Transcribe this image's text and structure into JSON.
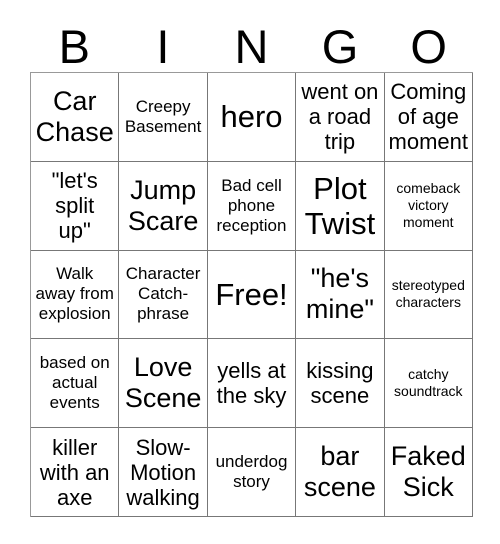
{
  "header": {
    "letters": [
      "B",
      "I",
      "N",
      "G",
      "O"
    ]
  },
  "grid": {
    "rows": [
      [
        {
          "text": "Car\nChase",
          "size": "lg"
        },
        {
          "text": "Creepy\nBasement",
          "size": "sm"
        },
        {
          "text": "hero",
          "size": "xl"
        },
        {
          "text": "went on\na road\ntrip",
          "size": "md"
        },
        {
          "text": "Coming\nof age\nmoment",
          "size": "md"
        }
      ],
      [
        {
          "text": "\"let's\nsplit\nup\"",
          "size": "md"
        },
        {
          "text": "Jump\nScare",
          "size": "lg"
        },
        {
          "text": "Bad cell\nphone\nreception",
          "size": "sm"
        },
        {
          "text": "Plot\nTwist",
          "size": "xl"
        },
        {
          "text": "comeback\nvictory\nmoment",
          "size": "xs"
        }
      ],
      [
        {
          "text": "Walk\naway from\nexplosion",
          "size": "sm"
        },
        {
          "text": "Character\nCatch-\nphrase",
          "size": "sm"
        },
        {
          "text": "Free!",
          "size": "xl"
        },
        {
          "text": "\"he's\nmine\"",
          "size": "lg"
        },
        {
          "text": "stereotyped\ncharacters",
          "size": "xs"
        }
      ],
      [
        {
          "text": "based on\nactual\nevents",
          "size": "sm"
        },
        {
          "text": "Love\nScene",
          "size": "lg"
        },
        {
          "text": "yells at\nthe sky",
          "size": "md"
        },
        {
          "text": "kissing\nscene",
          "size": "md"
        },
        {
          "text": "catchy\nsoundtrack",
          "size": "xs"
        }
      ],
      [
        {
          "text": "killer\nwith an\naxe",
          "size": "md"
        },
        {
          "text": "Slow-\nMotion\nwalking",
          "size": "md"
        },
        {
          "text": "underdog\nstory",
          "size": "sm"
        },
        {
          "text": "bar\nscene",
          "size": "lg"
        },
        {
          "text": "Faked\nSick",
          "size": "lg"
        }
      ]
    ]
  }
}
